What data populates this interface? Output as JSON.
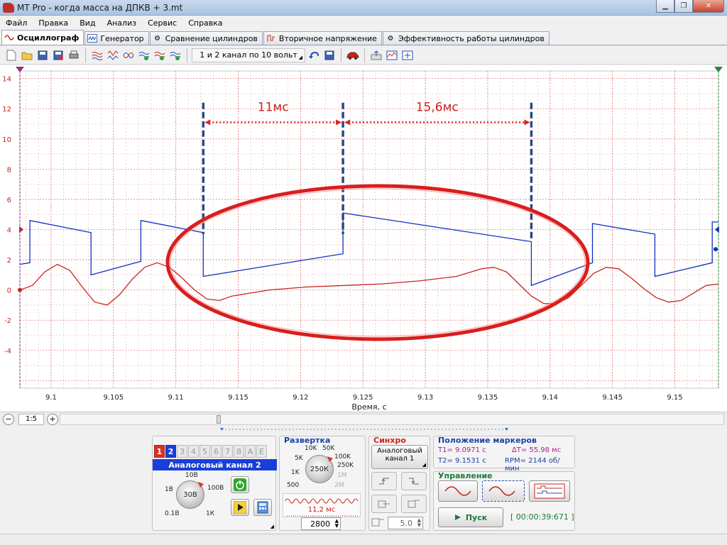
{
  "window": {
    "title": "MT Pro - когда масса на ДПКВ + 3.mt"
  },
  "menu": [
    "Файл",
    "Правка",
    "Вид",
    "Анализ",
    "Сервис",
    "Справка"
  ],
  "tabs": [
    {
      "label": "Осциллограф",
      "icon": "sine-wave-icon",
      "active": true
    },
    {
      "label": "Генератор",
      "icon": "generator-icon",
      "active": false
    },
    {
      "label": "Сравнение цилиндров",
      "icon": "gear-icon",
      "active": false
    },
    {
      "label": "Вторичное напряжение",
      "icon": "spark-icon",
      "active": false
    },
    {
      "label": "Эффективность работы цилиндров",
      "icon": "gear-icon",
      "active": false
    }
  ],
  "toolbar": {
    "preset": "1 и 2 канал по 10 вольт"
  },
  "chart_data": {
    "type": "line",
    "xlabel": "Время, с",
    "ylabel": "",
    "xlim": [
      9.0975,
      9.1535
    ],
    "ylim": [
      -6.5,
      14.5
    ],
    "x_ticks": [
      9.1,
      9.105,
      9.11,
      9.115,
      9.12,
      9.125,
      9.13,
      9.135,
      9.14,
      9.145,
      9.15
    ],
    "x_tick_labels": [
      "9.1",
      "9.105",
      "9.11",
      "9.115",
      "9.12",
      "9.125",
      "9.13",
      "9.135",
      "9.14",
      "9.145",
      "9.15"
    ],
    "y_ticks": [
      14,
      12,
      10,
      8,
      6,
      4,
      2,
      0,
      -2,
      -4
    ],
    "grid": true,
    "series": [
      {
        "color": "#1030c0",
        "x": [
          9.0975,
          9.0983,
          9.0983,
          9.1032,
          9.1032,
          9.1072,
          9.1072,
          9.1122,
          9.1122,
          9.1234,
          9.1234,
          9.1385,
          9.1385,
          9.1434,
          9.1434,
          9.1484,
          9.1484,
          9.153,
          9.153,
          9.1535
        ],
        "y": [
          1.7,
          1.8,
          4.6,
          3.8,
          1.0,
          1.9,
          4.6,
          3.8,
          0.9,
          2.4,
          5.1,
          3.2,
          0.3,
          1.8,
          4.4,
          3.7,
          0.9,
          1.8,
          4.5,
          4.5
        ]
      },
      {
        "color": "#c8241c",
        "x": [
          9.0975,
          9.0985,
          9.0995,
          9.1005,
          9.1015,
          9.1025,
          9.1035,
          9.1045,
          9.1055,
          9.1065,
          9.1075,
          9.1085,
          9.1095,
          9.1105,
          9.1115,
          9.1125,
          9.1135,
          9.1145,
          9.1175,
          9.1205,
          9.1235,
          9.1265,
          9.1295,
          9.1325,
          9.1345,
          9.1355,
          9.1365,
          9.1375,
          9.1385,
          9.1395,
          9.1405,
          9.1415,
          9.1425,
          9.1435,
          9.1445,
          9.1455,
          9.1465,
          9.1475,
          9.1485,
          9.1495,
          9.1505,
          9.1515,
          9.1525,
          9.1535
        ],
        "y": [
          0.0,
          0.3,
          1.2,
          1.7,
          1.3,
          0.2,
          -0.8,
          -1.0,
          -0.3,
          0.7,
          1.5,
          1.8,
          1.5,
          0.8,
          0.0,
          -0.6,
          -0.7,
          -0.4,
          0.0,
          0.2,
          0.3,
          0.4,
          0.6,
          0.9,
          1.4,
          1.5,
          1.2,
          0.4,
          -0.4,
          -0.9,
          -0.9,
          -0.5,
          0.3,
          1.1,
          1.5,
          1.4,
          0.8,
          0.1,
          -0.5,
          -0.8,
          -0.7,
          -0.2,
          0.3,
          0.4
        ]
      }
    ],
    "annotations": [
      {
        "text": "11мс",
        "color": "#cc2222"
      },
      {
        "text": "15,6мс",
        "color": "#cc2222"
      }
    ],
    "marker_times": [
      9.1122,
      9.1234,
      9.1385
    ]
  },
  "status": {
    "zoom": "1:5"
  },
  "channel": {
    "nums": [
      "1",
      "2",
      "3",
      "4",
      "5",
      "6",
      "7",
      "8",
      "A",
      "E"
    ],
    "active": "2",
    "name": "Аналоговый канал 2",
    "knob_value": "30В",
    "knob_labels": [
      "10В",
      "1В",
      "100В",
      "0.1В",
      "1К"
    ]
  },
  "sweep": {
    "title": "Развертка",
    "knob_value": "250К",
    "labels_dark": [
      "10K",
      "50K",
      "5K",
      "100K",
      "250K",
      "1K",
      "500"
    ],
    "labels_dim": [
      "1M",
      "2M"
    ],
    "period": "11,2 мс",
    "value": "2800"
  },
  "sync": {
    "title": "Синхро",
    "source_line1": "Аналоговый",
    "source_line2": "канал 1",
    "level": "5.0"
  },
  "markers": {
    "title": "Положение маркеров",
    "t1": "T1= 9.0971 с",
    "t2": "T2= 9.1531 с",
    "dt": "∆T= 55.98 мс",
    "rpm": "RPM= 2144 об/мин"
  },
  "control": {
    "title": "Управление",
    "start": "Пуск",
    "timer": "[ 00:00:39:671 ]"
  }
}
